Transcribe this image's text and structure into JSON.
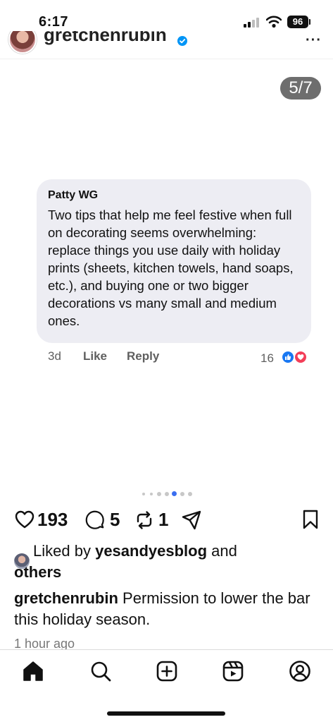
{
  "status_bar": {
    "time": "6:17",
    "battery": "96"
  },
  "header": {
    "username": "gretchenrubin",
    "more_label": "···"
  },
  "post": {
    "slide_counter": "5/7",
    "current_slide": 5,
    "total_slides": 7,
    "comment": {
      "author": "Patty WG",
      "text": "Two tips that help me feel festive when full on decorating seems overwhelming: replace things you use daily with holiday prints (sheets, kitchen towels, hand soaps, etc.), and buying one or two bigger decorations vs many small and medium ones.",
      "time": "3d",
      "like_label": "Like",
      "reply_label": "Reply",
      "reaction_count": "16"
    }
  },
  "actions": {
    "likes": "193",
    "comments": "5",
    "reposts": "1"
  },
  "liked_by": {
    "prefix": "Liked by",
    "user": "yesandyesblog",
    "conjunction": "and",
    "others": "others"
  },
  "caption": {
    "username": "gretchenrubin",
    "text": "Permission to lower the bar this holiday season."
  },
  "timestamp": "1 hour ago",
  "nav": [
    "home-icon",
    "search-icon",
    "create-icon",
    "reels-icon",
    "profile-icon"
  ],
  "colors": {
    "accent_blue": "#3b6ef0",
    "verified_blue": "#0095f6",
    "bubble_bg": "#ededf3",
    "like_reaction": "#1877f2",
    "love_reaction": "#f33e58"
  }
}
